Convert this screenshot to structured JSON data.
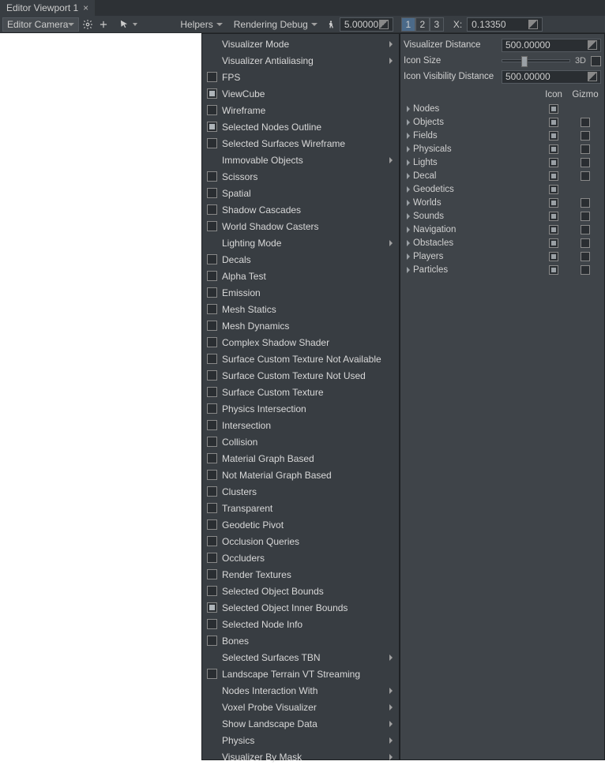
{
  "tab": {
    "title": "Editor Viewport 1"
  },
  "toolbar": {
    "camera_combo": "Editor Camera",
    "helpers": "Helpers",
    "rendering_debug": "Rendering Debug",
    "speed_value": "5.00000",
    "pages": [
      "1",
      "2",
      "3"
    ],
    "coord_label": "X:",
    "coord_value": "0.13350"
  },
  "menu": [
    {
      "label": "Visualizer Mode",
      "sub": true
    },
    {
      "label": "Visualizer Antialiasing",
      "sub": true
    },
    {
      "label": "FPS",
      "cb": true,
      "chk": false
    },
    {
      "label": "ViewCube",
      "cb": true,
      "chk": true
    },
    {
      "label": "Wireframe",
      "cb": true,
      "chk": false
    },
    {
      "label": "Selected Nodes Outline",
      "cb": true,
      "chk": true
    },
    {
      "label": "Selected Surfaces Wireframe",
      "cb": true,
      "chk": false
    },
    {
      "label": "Immovable Objects",
      "sub": true
    },
    {
      "label": "Scissors",
      "cb": true,
      "chk": false
    },
    {
      "label": "Spatial",
      "cb": true,
      "chk": false
    },
    {
      "label": "Shadow Cascades",
      "cb": true,
      "chk": false
    },
    {
      "label": "World Shadow Casters",
      "cb": true,
      "chk": false
    },
    {
      "label": "Lighting Mode",
      "sub": true
    },
    {
      "label": "Decals",
      "cb": true,
      "chk": false
    },
    {
      "label": "Alpha Test",
      "cb": true,
      "chk": false
    },
    {
      "label": "Emission",
      "cb": true,
      "chk": false
    },
    {
      "label": "Mesh Statics",
      "cb": true,
      "chk": false
    },
    {
      "label": "Mesh Dynamics",
      "cb": true,
      "chk": false
    },
    {
      "label": "Complex Shadow Shader",
      "cb": true,
      "chk": false
    },
    {
      "label": "Surface Custom Texture Not Available",
      "cb": true,
      "chk": false
    },
    {
      "label": "Surface Custom Texture Not Used",
      "cb": true,
      "chk": false
    },
    {
      "label": "Surface Custom Texture",
      "cb": true,
      "chk": false
    },
    {
      "label": "Physics Intersection",
      "cb": true,
      "chk": false
    },
    {
      "label": "Intersection",
      "cb": true,
      "chk": false
    },
    {
      "label": "Collision",
      "cb": true,
      "chk": false
    },
    {
      "label": "Material Graph Based",
      "cb": true,
      "chk": false
    },
    {
      "label": "Not Material Graph Based",
      "cb": true,
      "chk": false
    },
    {
      "label": "Clusters",
      "cb": true,
      "chk": false
    },
    {
      "label": "Transparent",
      "cb": true,
      "chk": false
    },
    {
      "label": "Geodetic Pivot",
      "cb": true,
      "chk": false
    },
    {
      "label": "Occlusion Queries",
      "cb": true,
      "chk": false
    },
    {
      "label": "Occluders",
      "cb": true,
      "chk": false
    },
    {
      "label": "Render Textures",
      "cb": true,
      "chk": false
    },
    {
      "label": "Selected Object Bounds",
      "cb": true,
      "chk": false
    },
    {
      "label": "Selected Object Inner Bounds",
      "cb": true,
      "chk": true
    },
    {
      "label": "Selected Node Info",
      "cb": true,
      "chk": false
    },
    {
      "label": "Bones",
      "cb": true,
      "chk": false
    },
    {
      "label": "Selected Surfaces TBN",
      "sub": true
    },
    {
      "label": "Landscape Terrain VT Streaming",
      "cb": true,
      "chk": false
    },
    {
      "label": "Nodes Interaction With",
      "sub": true
    },
    {
      "label": "Voxel Probe Visualizer",
      "sub": true
    },
    {
      "label": "Show Landscape Data",
      "sub": true
    },
    {
      "label": "Physics",
      "sub": true
    },
    {
      "label": "Visualizer By Mask",
      "sub": true
    }
  ],
  "panel": {
    "vis_dist_label": "Visualizer Distance",
    "vis_dist_value": "500.00000",
    "icon_size_label": "Icon Size",
    "icon_3d_label": "3D",
    "icon_vis_label": "Icon Visibility Distance",
    "icon_vis_value": "500.00000",
    "col_icon": "Icon",
    "col_gizmo": "Gizmo",
    "rows": [
      {
        "label": "Nodes",
        "icon": "chk",
        "gizmo": null
      },
      {
        "label": "Objects",
        "icon": "chk",
        "gizmo": "off"
      },
      {
        "label": "Fields",
        "icon": "on",
        "gizmo": "off"
      },
      {
        "label": "Physicals",
        "icon": "on",
        "gizmo": "off"
      },
      {
        "label": "Lights",
        "icon": "on",
        "gizmo": "off"
      },
      {
        "label": "Decal",
        "icon": "chk",
        "gizmo": "off"
      },
      {
        "label": "Geodetics",
        "icon": "on",
        "gizmo": null
      },
      {
        "label": "Worlds",
        "icon": "on",
        "gizmo": "off"
      },
      {
        "label": "Sounds",
        "icon": "on",
        "gizmo": "off"
      },
      {
        "label": "Navigation",
        "icon": "on",
        "gizmo": "off"
      },
      {
        "label": "Obstacles",
        "icon": "on",
        "gizmo": "off"
      },
      {
        "label": "Players",
        "icon": "chk",
        "gizmo": "off"
      },
      {
        "label": "Particles",
        "icon": "chk",
        "gizmo": "off"
      }
    ]
  }
}
